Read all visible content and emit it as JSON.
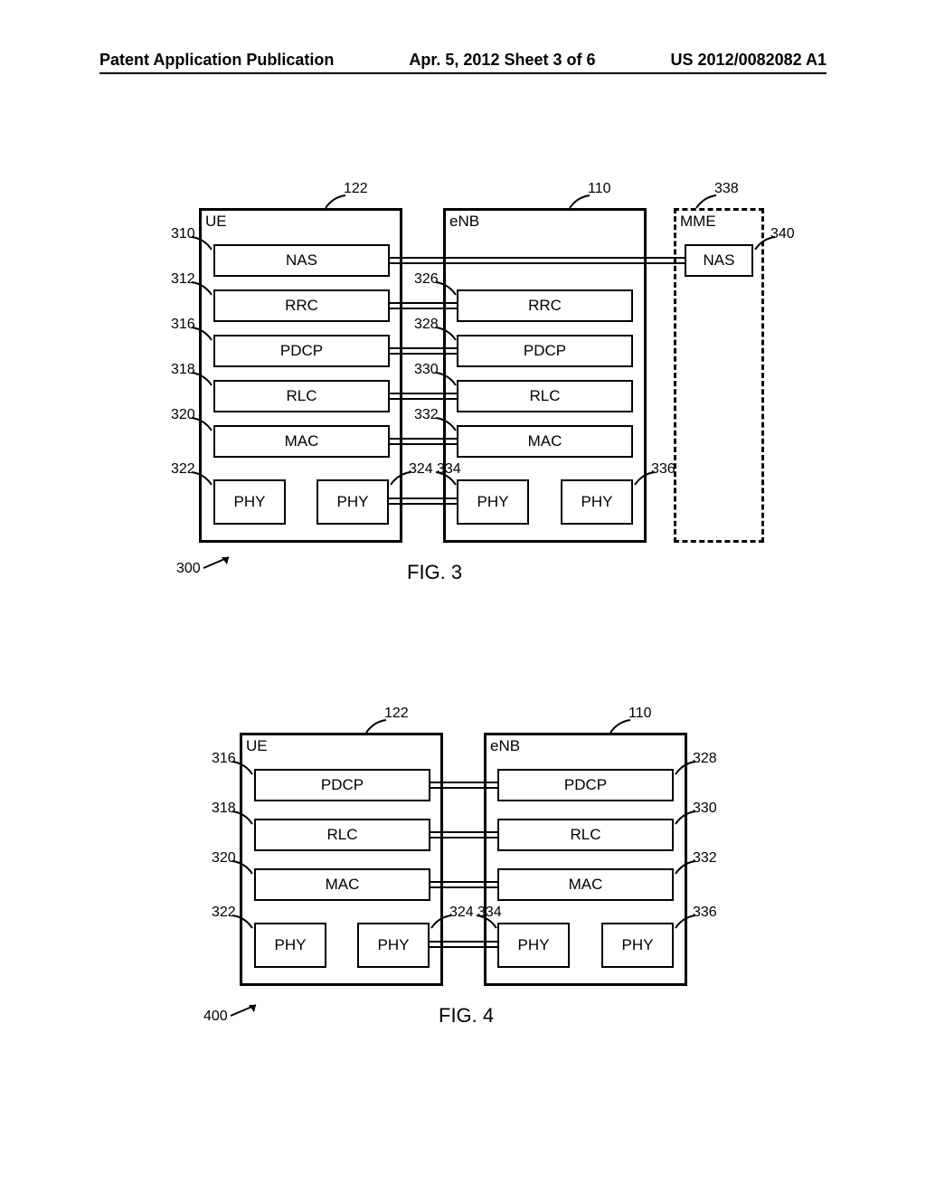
{
  "header": {
    "left": "Patent Application Publication",
    "center": "Apr. 5, 2012  Sheet 3 of 6",
    "right": "US 2012/0082082 A1"
  },
  "fig3": {
    "caption": "FIG. 3",
    "ref_diagram": "300",
    "entities": {
      "ue": {
        "label": "UE",
        "ref": "122"
      },
      "enb": {
        "label": "eNB",
        "ref": "110"
      },
      "mme": {
        "label": "MME",
        "ref": "338"
      }
    },
    "ue_layers": {
      "nas": {
        "label": "NAS",
        "ref": "310"
      },
      "rrc": {
        "label": "RRC",
        "ref": "312"
      },
      "pdcp": {
        "label": "PDCP",
        "ref": "316"
      },
      "rlc": {
        "label": "RLC",
        "ref": "318"
      },
      "mac": {
        "label": "MAC",
        "ref": "320"
      },
      "phy1": {
        "label": "PHY",
        "ref": "322"
      },
      "phy2": {
        "label": "PHY",
        "ref": "324"
      }
    },
    "enb_layers": {
      "rrc": {
        "label": "RRC",
        "ref": "326"
      },
      "pdcp": {
        "label": "PDCP",
        "ref": "328"
      },
      "rlc": {
        "label": "RLC",
        "ref": "330"
      },
      "mac": {
        "label": "MAC",
        "ref": "332"
      },
      "phy1": {
        "label": "PHY",
        "ref": "334"
      },
      "phy2": {
        "label": "PHY",
        "ref": "336"
      }
    },
    "mme_layers": {
      "nas": {
        "label": "NAS",
        "ref": "340"
      }
    }
  },
  "fig4": {
    "caption": "FIG. 4",
    "ref_diagram": "400",
    "entities": {
      "ue": {
        "label": "UE",
        "ref": "122"
      },
      "enb": {
        "label": "eNB",
        "ref": "110"
      }
    },
    "ue_layers": {
      "pdcp": {
        "label": "PDCP",
        "ref": "316"
      },
      "rlc": {
        "label": "RLC",
        "ref": "318"
      },
      "mac": {
        "label": "MAC",
        "ref": "320"
      },
      "phy1": {
        "label": "PHY",
        "ref": "322"
      },
      "phy2": {
        "label": "PHY",
        "ref": "324"
      }
    },
    "enb_layers": {
      "pdcp": {
        "label": "PDCP",
        "ref": "328"
      },
      "rlc": {
        "label": "RLC",
        "ref": "330"
      },
      "mac": {
        "label": "MAC",
        "ref": "332"
      },
      "phy1": {
        "label": "PHY",
        "ref": "334"
      },
      "phy2": {
        "label": "PHY",
        "ref": "336"
      }
    }
  }
}
